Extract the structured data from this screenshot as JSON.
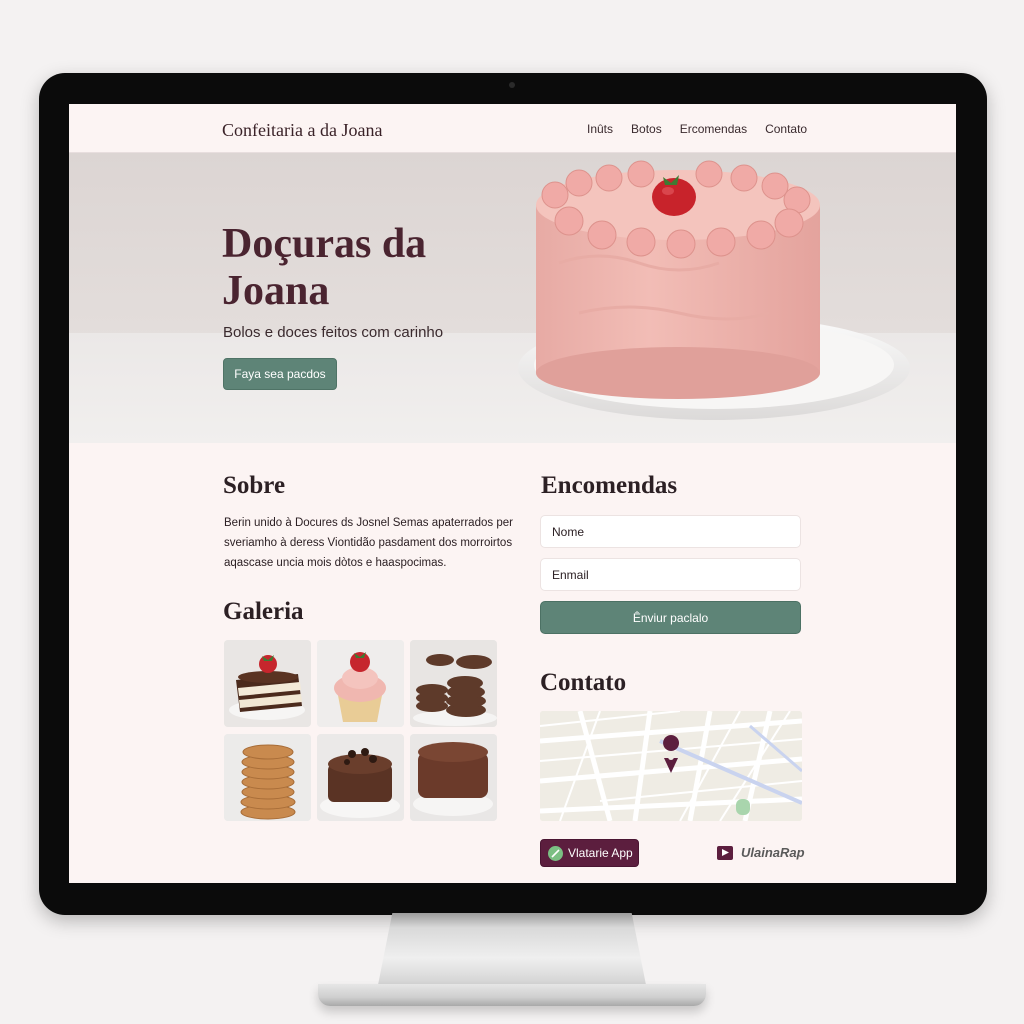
{
  "header": {
    "brand": "Confeitaria a da Joana",
    "nav": [
      "Inûts",
      "Botos",
      "Ercomendas",
      "Contato"
    ]
  },
  "hero": {
    "title": "Doçuras da Joana",
    "subtitle": "Bolos e doces feitos com carinho",
    "cta_label": "Faya sea pacdos"
  },
  "sobre": {
    "title": "Sobre",
    "text": "Berin unido à Docures ds Josnel Semas apaterrados per sveriamho à deress Viontidão pasdament dos morroirtos aqascase uncia mois dòtos e haaspocimas."
  },
  "galeria": {
    "title": "Galeria",
    "images": [
      "layer-cake-slice",
      "strawberry-cupcake",
      "chocolate-cookie-stacks",
      "cookie-stack",
      "chocolate-chip-cake",
      "chocolate-cake"
    ]
  },
  "encomendas": {
    "title": "Encomendas",
    "name_placeholder": "Nome",
    "email_placeholder": "Enmail",
    "submit_label": "Ênviur paclalo"
  },
  "contato": {
    "title": "Contato",
    "app_label": "Vlatarie App",
    "partner_label": "UlainaRap"
  },
  "colors": {
    "accent_green": "#5e8477",
    "accent_plum": "#5c1e3e",
    "background": "#fcf4f3",
    "text_dark": "#2c2024"
  }
}
